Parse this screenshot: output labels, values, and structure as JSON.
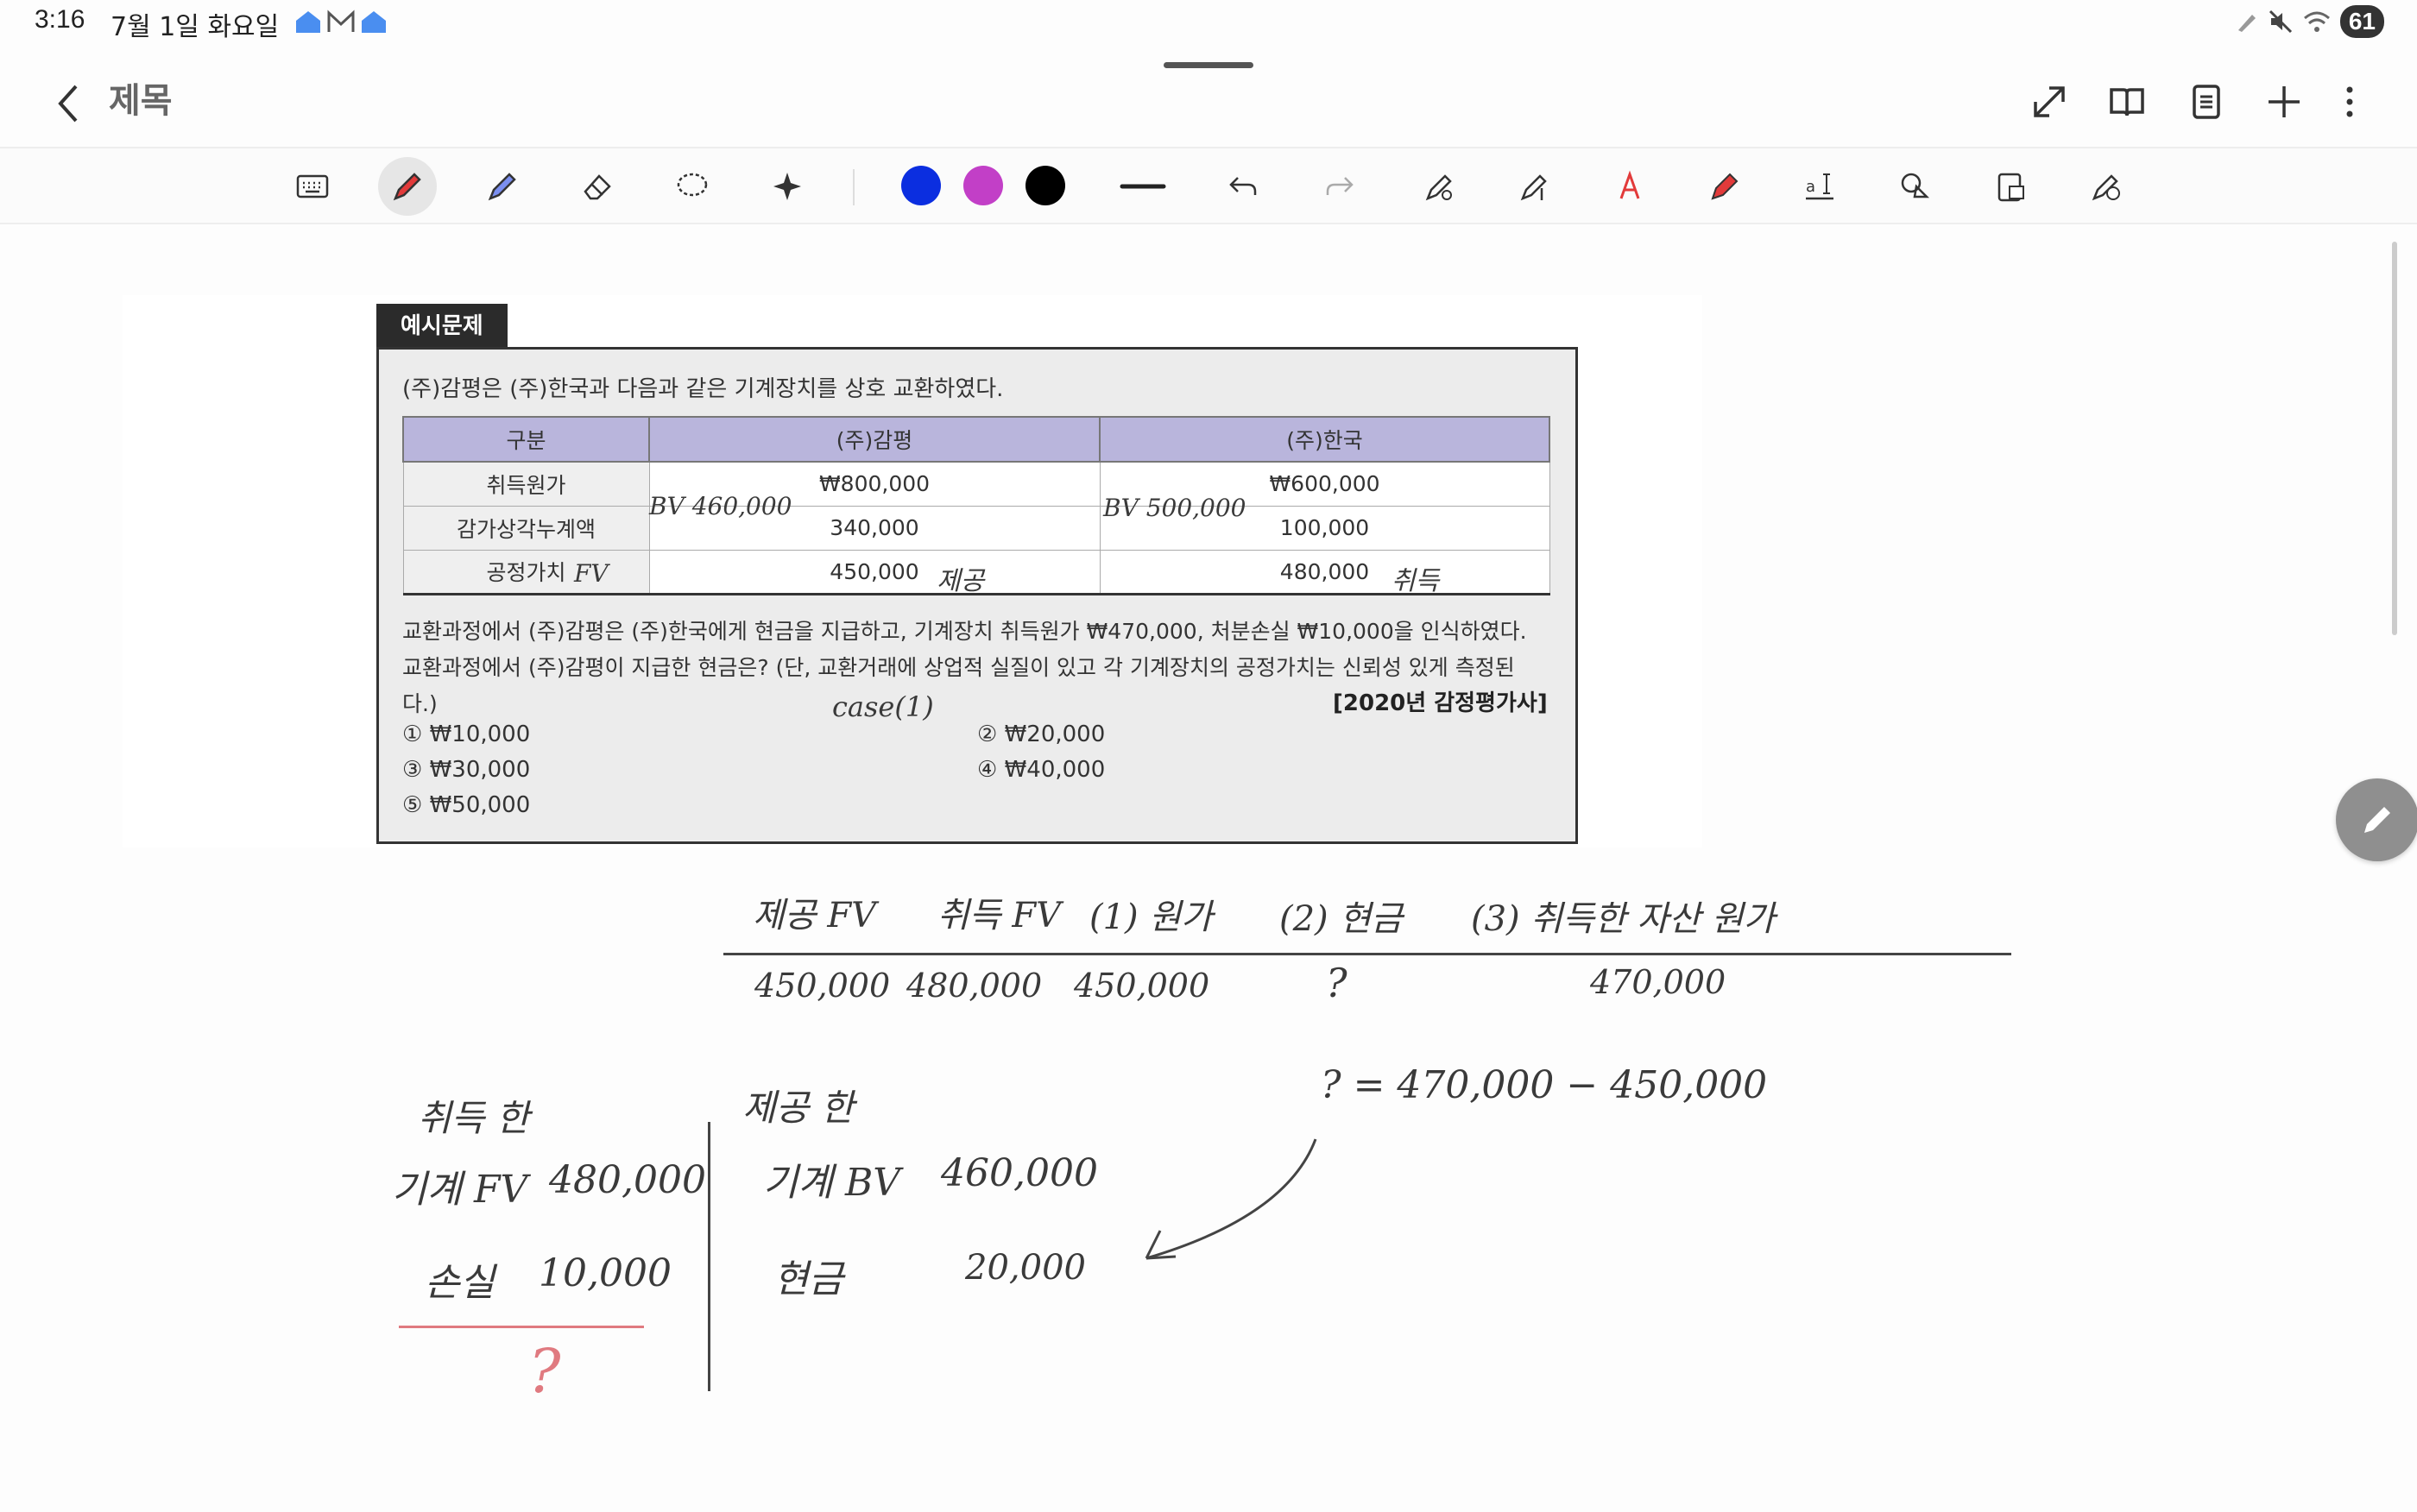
{
  "status": {
    "time": "3:16",
    "date": "7월 1일 화요일",
    "battery": "61"
  },
  "header": {
    "title": "제목"
  },
  "toolbar": {
    "colors": [
      "#0b2ee0",
      "#c23fc7",
      "#000000"
    ]
  },
  "problem": {
    "tag": "예시문제",
    "intro": "(주)감평은 (주)한국과 다음과 같은 기계장치를 상호 교환하였다.",
    "table": {
      "headers": [
        "구분",
        "(주)감평",
        "(주)한국"
      ],
      "rows": [
        [
          "취득원가",
          "₩800,000",
          "₩600,000"
        ],
        [
          "감가상각누계액",
          "340,000",
          "100,000"
        ],
        [
          "공정가치",
          "450,000",
          "480,000"
        ]
      ]
    },
    "body1": "교환과정에서 (주)감평은 (주)한국에게 현금을 지급하고, 기계장치 취득원가 ₩470,000, 처분손실 ₩10,000을 인식하였다.",
    "body2": "교환과정에서 (주)감평이 지급한 현금은? (단, 교환거래에 상업적 실질이 있고 각 기계장치의 공정가치는 신뢰성 있게 측정된",
    "body3": "다.)",
    "source": "[2020년 감정평가사]",
    "options": [
      "① ₩10,000",
      "② ₩20,000",
      "③ ₩30,000",
      "④ ₩40,000",
      "⑤ ₩50,000"
    ]
  },
  "annotations": {
    "bv1": "BV 460,000",
    "bv2": "BV 500,000",
    "fv": "FV",
    "give": "제공",
    "receive": "취득",
    "case": "case(1)"
  },
  "notes": {
    "headers": [
      "제공 FV",
      "취득 FV",
      "(1) 원가",
      "(2) 현금",
      "(3) 취득한 자산 원가"
    ],
    "values": [
      "450,000",
      "480,000",
      "450,000",
      "?",
      "470,000"
    ],
    "equation": "? = 470,000 − 450,000",
    "left_title": "취득 한",
    "left_row1_label": "기계 FV",
    "left_row1_value": "480,000",
    "left_row2_label": "손실",
    "left_row2_value": "10,000",
    "left_q": "?",
    "right_title": "제공 한",
    "right_row1_label": "기계 BV",
    "right_row1_value": "460,000",
    "right_row2_label": "현금",
    "right_row2_value": "20,000"
  }
}
